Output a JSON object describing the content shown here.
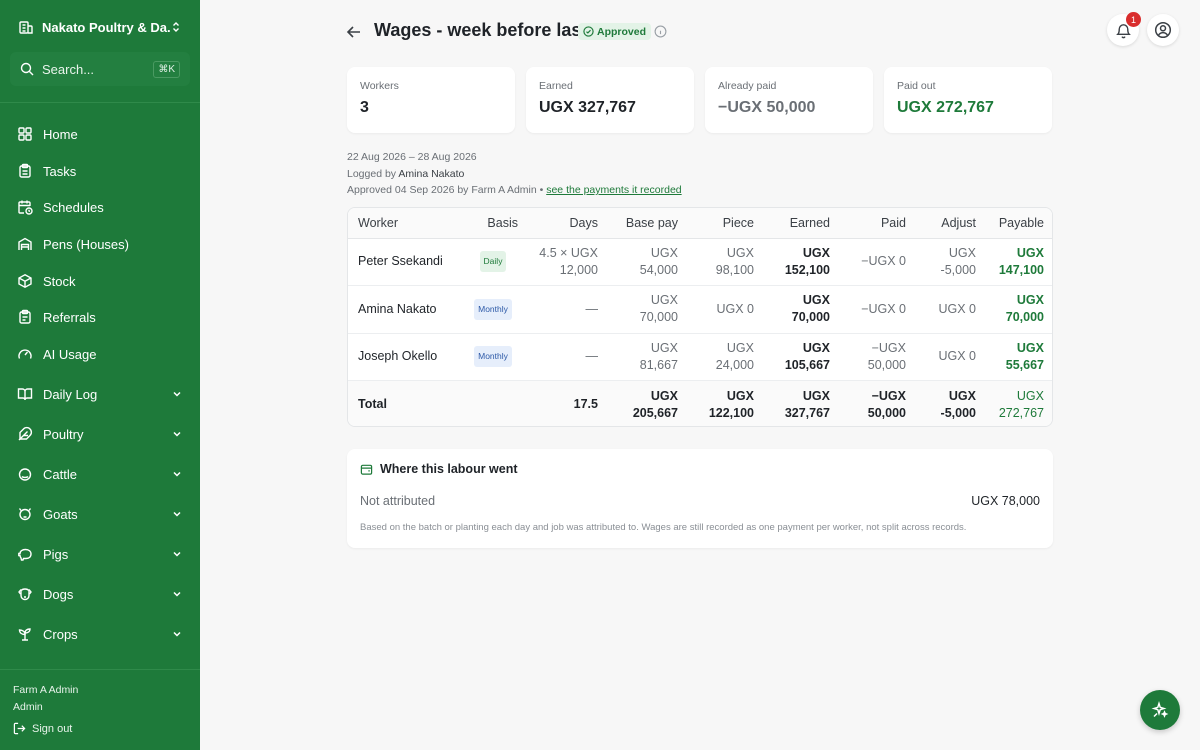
{
  "sidebar": {
    "farm_name": "Nakato Poultry & Da...",
    "search_placeholder": "Search...",
    "search_shortcut": "⌘K",
    "items": [
      {
        "label": "Home",
        "icon": "grid-icon"
      },
      {
        "label": "Tasks",
        "icon": "clipboard-icon"
      },
      {
        "label": "Schedules",
        "icon": "calendar-clock-icon"
      },
      {
        "label": "Pens (Houses)",
        "icon": "warehouse-icon"
      },
      {
        "label": "Stock",
        "icon": "box-icon"
      },
      {
        "label": "Referrals",
        "icon": "clipboard-icon"
      },
      {
        "label": "AI Usage",
        "icon": "gauge-icon"
      },
      {
        "label": "Daily Log",
        "icon": "book-open-icon"
      },
      {
        "label": "Poultry",
        "icon": "feather-icon"
      },
      {
        "label": "Cattle",
        "icon": "cattle-icon"
      },
      {
        "label": "Goats",
        "icon": "goat-icon"
      },
      {
        "label": "Pigs",
        "icon": "pig-icon"
      },
      {
        "label": "Dogs",
        "icon": "dog-icon"
      },
      {
        "label": "Crops",
        "icon": "sprout-icon"
      }
    ],
    "user_name": "Farm A Admin",
    "user_role": "Admin",
    "sign_out": "Sign out"
  },
  "header": {
    "title": "Wages - week before last",
    "status": "Approved",
    "notification_count": "1"
  },
  "summary": [
    {
      "label": "Workers",
      "value": "3"
    },
    {
      "label": "Earned",
      "value": "UGX 327,767"
    },
    {
      "label": "Already paid",
      "value": "−UGX 50,000"
    },
    {
      "label": "Paid out",
      "value": "UGX 272,767"
    }
  ],
  "meta": {
    "date_range": "22 Aug 2026 – 28 Aug 2026",
    "logged_prefix": "Logged by ",
    "logged_by": "Amina Nakato",
    "approved_text": "Approved 04 Sep 2026 by Farm A Admin • ",
    "payments_link": "see the payments it recorded"
  },
  "table": {
    "headers": [
      "Worker",
      "Basis",
      "Days",
      "Base pay",
      "Piece",
      "Earned",
      "Paid",
      "Adjust",
      "Payable"
    ],
    "rows": [
      {
        "worker": "Peter Ssekandi",
        "basis": "Daily",
        "days": "4.5 × UGX 12,000",
        "base_pay": "UGX 54,000",
        "piece": "UGX 98,100",
        "earned": "UGX 152,100",
        "paid": "−UGX 0",
        "adjust": "UGX -5,000",
        "payable": "UGX 147,100"
      },
      {
        "worker": "Amina Nakato",
        "basis": "Monthly",
        "days": "—",
        "base_pay": "UGX 70,000",
        "piece": "UGX 0",
        "earned": "UGX 70,000",
        "paid": "−UGX 0",
        "adjust": "UGX 0",
        "payable": "UGX 70,000"
      },
      {
        "worker": "Joseph Okello",
        "basis": "Monthly",
        "days": "—",
        "base_pay": "UGX 81,667",
        "piece": "UGX 24,000",
        "earned": "UGX 105,667",
        "paid": "−UGX 50,000",
        "adjust": "UGX 0",
        "payable": "UGX 55,667"
      }
    ],
    "total": {
      "label": "Total",
      "days": "17.5",
      "base_pay": "UGX 205,667",
      "piece": "UGX 122,100",
      "earned": "UGX 327,767",
      "paid": "−UGX 50,000",
      "adjust": "UGX -5,000",
      "payable": "UGX 272,767"
    }
  },
  "labour": {
    "title": "Where this labour went",
    "row_label": "Not attributed",
    "row_value": "UGX 78,000",
    "note": "Based on the batch or planting each day and job was attributed to. Wages are still recorded as one payment per worker, not split across records."
  },
  "colors": {
    "brand": "#1e7a3a",
    "badge_red": "#d92d2d"
  }
}
